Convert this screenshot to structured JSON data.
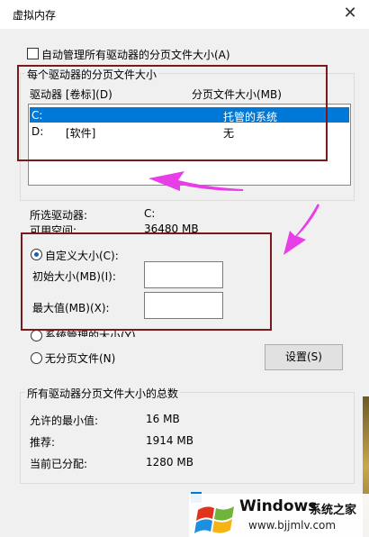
{
  "window": {
    "title": "虚拟内存",
    "close_glyph": "✕"
  },
  "auto_manage": {
    "label": "自动管理所有驱动器的分页文件大小(A)",
    "checked": false
  },
  "drives_group": {
    "legend": "每个驱动器的分页文件大小",
    "col_drive": "驱动器 [卷标](D)",
    "col_size": "分页文件大小(MB)",
    "rows": [
      {
        "drive": "C:",
        "label": "",
        "size": "托管的系统",
        "selected": true
      },
      {
        "drive": "D:",
        "label": "[软件]",
        "size": "无",
        "selected": false
      }
    ]
  },
  "selected_drive": {
    "label": "所选驱动器:",
    "value": "C:"
  },
  "available_space": {
    "label": "可用空间:",
    "value": "36480 MB"
  },
  "custom_size": {
    "label": "自定义大小(C):",
    "selected": true,
    "initial_label": "初始大小(MB)(I):",
    "initial_value": "",
    "max_label": "最大值(MB)(X):",
    "max_value": ""
  },
  "system_managed": {
    "label": "系统管理的大小(Y)",
    "selected": false
  },
  "no_paging": {
    "label": "无分页文件(N)",
    "selected": false
  },
  "set_button": "设置(S)",
  "totals_group": {
    "legend": "所有驱动器分页文件大小的总数",
    "rows": [
      {
        "label": "允许的最小值:",
        "value": "16 MB"
      },
      {
        "label": "推荐:",
        "value": "1914 MB"
      },
      {
        "label": "当前已分配:",
        "value": "1280 MB"
      }
    ]
  },
  "watermark": {
    "brand": "Windows",
    "site_cn": "系统之家",
    "url": "www.bjjmlv.com"
  },
  "colors": {
    "selection": "#0078d7",
    "annotation_box": "#7a1a1a",
    "annotation_arrow": "#e83ee8"
  }
}
